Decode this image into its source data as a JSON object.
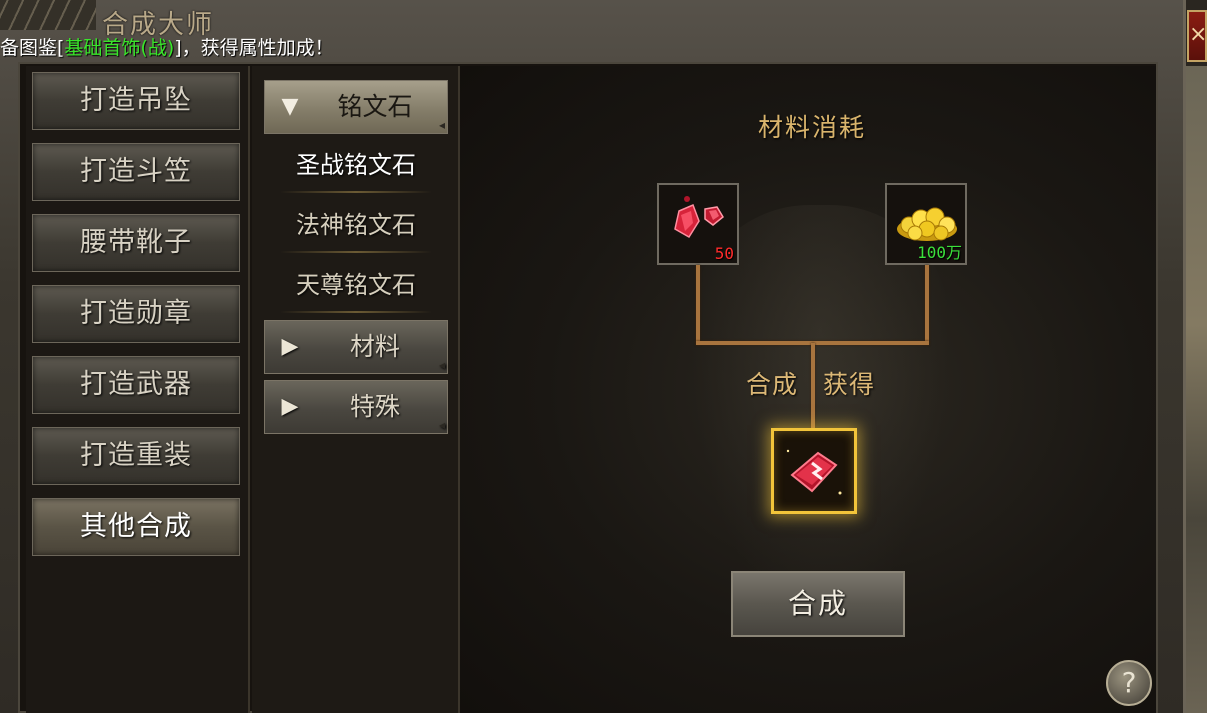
{
  "window": {
    "title": "合成大师",
    "notice_prefix": "备图鉴[",
    "notice_highlight": "基础首饰(战)",
    "notice_suffix": "]，获得属性加成！"
  },
  "categories": [
    {
      "label": "打造吊坠"
    },
    {
      "label": "打造斗笠"
    },
    {
      "label": "腰带靴子"
    },
    {
      "label": "打造勋章"
    },
    {
      "label": "打造武器"
    },
    {
      "label": "打造重装"
    },
    {
      "label": "其他合成"
    }
  ],
  "active_category": "其他合成",
  "groups": {
    "open": {
      "label": "铭文石",
      "items": [
        "圣战铭文石",
        "法神铭文石",
        "天尊铭文石"
      ],
      "selected": "圣战铭文石"
    },
    "collapsed": [
      {
        "label": "材料"
      },
      {
        "label": "特殊"
      }
    ]
  },
  "recipe": {
    "title": "材料消耗",
    "materials": [
      {
        "icon": "red-gem-icon",
        "count": "50",
        "count_color": "#ff2b2b"
      },
      {
        "icon": "gold-coins-icon",
        "count": "100万",
        "count_color": "#3be03b"
      }
    ],
    "result_label_left": "合成",
    "result_label_right": "获得",
    "result_icon": "red-rune-stone-icon",
    "combine_label": "合成",
    "help_label": "?"
  },
  "close_label": "×",
  "colors": {
    "accent_gold": "#d9b46c",
    "highlight_green": "#39e52a",
    "glow_yellow": "#f2c43a",
    "connector": "#a8743e"
  }
}
